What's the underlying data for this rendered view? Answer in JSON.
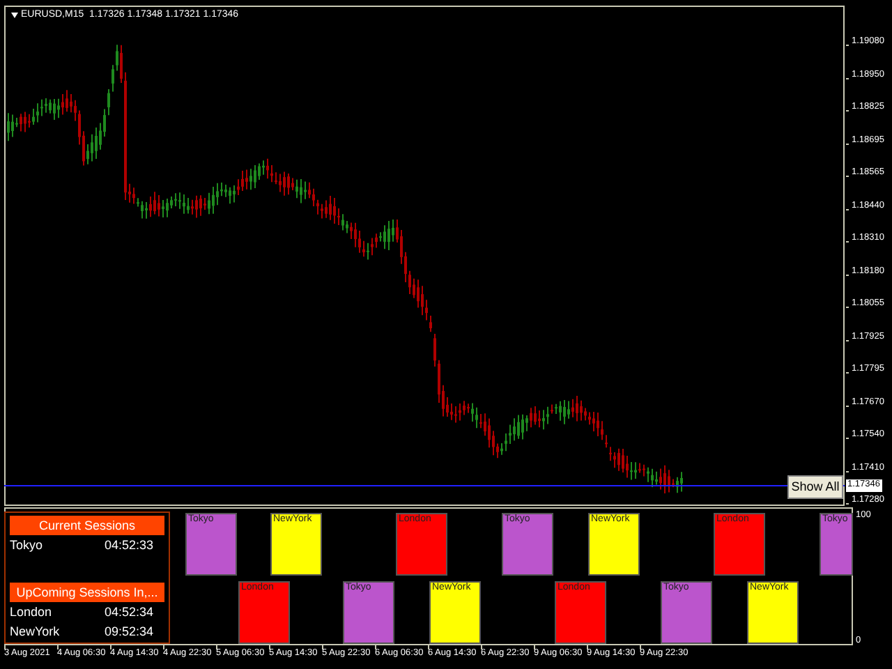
{
  "chart": {
    "symbol_info": "EURUSD,M15  1.17326 1.17348 1.17321 1.17346",
    "price_axis": [
      "1.19080",
      "1.18950",
      "1.18825",
      "1.18695",
      "1.18565",
      "1.18440",
      "1.18310",
      "1.18180",
      "1.18055",
      "1.17925",
      "1.17795",
      "1.17670",
      "1.17540",
      "1.17410",
      "1.17280"
    ],
    "current_price": "1.17346",
    "show_all_button": "Show All"
  },
  "sessions_panel": {
    "current_title": "Current Sessions",
    "current": [
      {
        "name": "Tokyo",
        "time": "04:52:33"
      }
    ],
    "upcoming_title": "UpComing Sessions In,...",
    "upcoming": [
      {
        "name": "London",
        "time": "04:52:34"
      },
      {
        "name": "NewYork",
        "time": "09:52:34"
      }
    ]
  },
  "session_blocks": {
    "top_row": [
      {
        "label": "Tokyo",
        "color": "#bb55cc"
      },
      {
        "label": "NewYork",
        "color": "#ffff00"
      },
      {
        "label": "London",
        "color": "#ff0000"
      },
      {
        "label": "Tokyo",
        "color": "#bb55cc"
      },
      {
        "label": "NewYork",
        "color": "#ffff00"
      },
      {
        "label": "London",
        "color": "#ff0000"
      },
      {
        "label": "Tokyo",
        "color": "#bb55cc"
      }
    ],
    "bottom_row": [
      {
        "label": "London",
        "color": "#ff0000"
      },
      {
        "label": "Tokyo",
        "color": "#bb55cc"
      },
      {
        "label": "NewYork",
        "color": "#ffff00"
      },
      {
        "label": "London",
        "color": "#ff0000"
      },
      {
        "label": "Tokyo",
        "color": "#bb55cc"
      },
      {
        "label": "NewYork",
        "color": "#ffff00"
      }
    ]
  },
  "indicator_scale": [
    "100",
    "0"
  ],
  "time_axis": [
    "3 Aug 2021",
    "4 Aug 06:30",
    "4 Aug 14:30",
    "4 Aug 22:30",
    "5 Aug 06:30",
    "5 Aug 14:30",
    "5 Aug 22:30",
    "6 Aug 06:30",
    "6 Aug 14:30",
    "6 Aug 22:30",
    "9 Aug 06:30",
    "9 Aug 14:30",
    "9 Aug 22:30"
  ]
}
